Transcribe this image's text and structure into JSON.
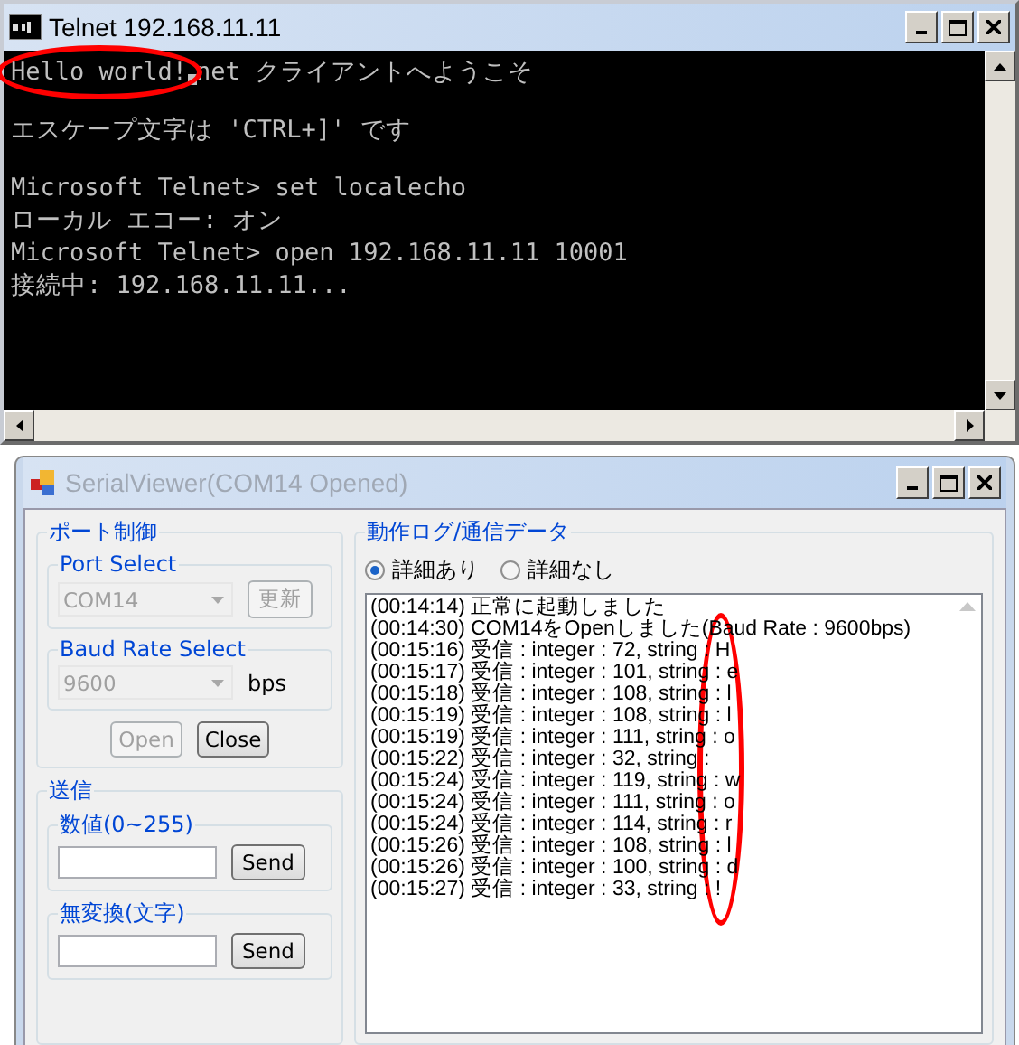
{
  "telnet": {
    "title": "Telnet 192.168.11.11",
    "console": {
      "lines": [
        {
          "spaced": false,
          "segments": [
            {
              "kind": "text",
              "text": "Hello world!",
              "circled": true
            },
            {
              "kind": "cursor"
            },
            {
              "kind": "text",
              "text": "net クライアントへようこそ",
              "circled": false
            }
          ]
        },
        {
          "spaced": true,
          "segments": [
            {
              "kind": "text",
              "text": "エスケープ文字は 'CTRL+]' です",
              "circled": false
            }
          ]
        },
        {
          "spaced": true,
          "segments": [
            {
              "kind": "text",
              "text": "Microsoft Telnet> set localecho",
              "circled": false
            }
          ]
        },
        {
          "spaced": false,
          "segments": [
            {
              "kind": "text",
              "text": "ローカル エコー: オン",
              "circled": false
            }
          ]
        },
        {
          "spaced": false,
          "segments": [
            {
              "kind": "text",
              "text": "Microsoft Telnet> open 192.168.11.11 10001",
              "circled": false
            }
          ]
        },
        {
          "spaced": false,
          "segments": [
            {
              "kind": "text",
              "text": "接続中: 192.168.11.11...",
              "circled": false
            }
          ]
        }
      ]
    }
  },
  "serial": {
    "title": "SerialViewer(COM14 Opened)",
    "active": false,
    "port_group": {
      "title": "ポート制御",
      "port_select": {
        "label": "Port Select",
        "value": "COM14",
        "disabled": true,
        "button": {
          "label": "更新",
          "disabled": true
        }
      },
      "baud_select": {
        "label": "Baud Rate Select",
        "value": "9600",
        "disabled": true,
        "unit": "bps"
      },
      "buttons": [
        {
          "label": "Open",
          "disabled": true
        },
        {
          "label": "Close",
          "disabled": false
        }
      ]
    },
    "send_group": {
      "title": "送信",
      "fields": [
        {
          "label": "数値(0~255)",
          "button": "Send"
        },
        {
          "label": "無変換(文字)",
          "button": "Send"
        }
      ]
    },
    "log_group": {
      "title": "動作ログ/通信データ",
      "radios": [
        {
          "label": "詳細あり",
          "selected": true
        },
        {
          "label": "詳細なし",
          "selected": false
        }
      ],
      "annotated": true,
      "lines": [
        "(00:14:14) 正常に起動しました",
        "(00:14:30) COM14をOpenしました(Baud Rate : 9600bps)",
        "(00:15:16) 受信 : integer : 72, string : H",
        "(00:15:17) 受信 : integer : 101, string : e",
        "(00:15:18) 受信 : integer : 108, string : l",
        "(00:15:19) 受信 : integer : 108, string : l",
        "(00:15:19) 受信 : integer : 111, string : o",
        "(00:15:22) 受信 : integer : 32, string : ",
        "(00:15:24) 受信 : integer : 119, string : w",
        "(00:15:24) 受信 : integer : 111, string : o",
        "(00:15:24) 受信 : integer : 114, string : r",
        "(00:15:26) 受信 : integer : 108, string : l",
        "(00:15:26) 受信 : integer : 100, string : d",
        "(00:15:27) 受信 : integer : 33, string : !"
      ]
    }
  }
}
